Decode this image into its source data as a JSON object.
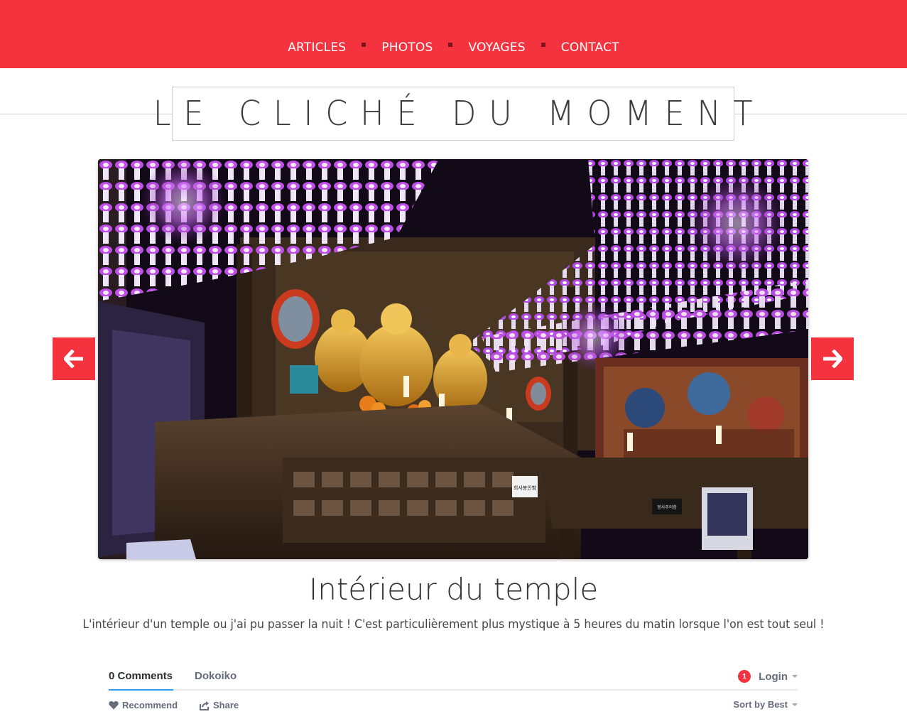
{
  "nav": {
    "items": [
      "ARTICLES",
      "PHOTOS",
      "VOYAGES",
      "CONTACT"
    ]
  },
  "site": {
    "title": "LE CLICHÉ DU MOMENT"
  },
  "photo": {
    "title": "Intérieur du temple",
    "description": "L'intérieur d'un temple ou j'ai pu passer la nuit ! C'est particulièrement plus mystique à 5 heures du matin lorsque l'on est tout seul !",
    "sign_left": "희사봉안함",
    "sign_right": "봉사주의함"
  },
  "comments": {
    "count_tab": "0 Comments",
    "site_tab": "Dokoiko",
    "notification_count": "1",
    "login_label": "Login",
    "recommend_label": "Recommend",
    "share_label": "Share",
    "sort_label": "Sort by Best"
  },
  "colors": {
    "brand_red": "#f5333f",
    "nav_separator": "#7a1420",
    "tab_underline": "#2e9fff"
  },
  "icons": {
    "prev": "arrow-left-icon",
    "next": "arrow-right-icon",
    "recommend": "heart-icon",
    "share": "share-icon"
  }
}
